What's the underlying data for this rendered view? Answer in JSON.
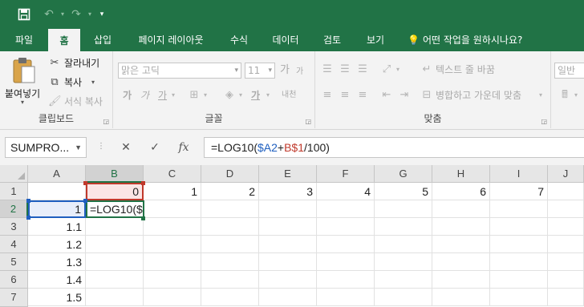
{
  "quick_access": {
    "save_icon": "save-icon",
    "undo_icon": "undo-icon",
    "redo_icon": "redo-icon",
    "customize_icon": "customize-icon"
  },
  "tabs": [
    {
      "label": "파일",
      "active": false
    },
    {
      "label": "홈",
      "active": true
    },
    {
      "label": "삽입",
      "active": false
    },
    {
      "label": "페이지 레이아웃",
      "active": false
    },
    {
      "label": "수식",
      "active": false
    },
    {
      "label": "데이터",
      "active": false
    },
    {
      "label": "검토",
      "active": false
    },
    {
      "label": "보기",
      "active": false
    }
  ],
  "tell_me": "어떤 작업을 원하시나요?",
  "ribbon": {
    "clipboard": {
      "paste_label": "붙여넣기",
      "cut_label": "잘라내기",
      "copy_label": "복사",
      "format_painter_label": "서식 복사",
      "group_label": "클립보드"
    },
    "font": {
      "font_name": "맑은 고딕",
      "font_size": "11",
      "bold": "가",
      "italic": "가",
      "underline": "가",
      "font_color": "가",
      "phonetic": "내천",
      "grow_font": "가",
      "shrink_font": "가",
      "group_label": "글꼴"
    },
    "alignment": {
      "wrap_text_label": "텍스트 줄 바꿈",
      "merge_center_label": "병합하고 가운데 맞춤",
      "group_label": "맞춤"
    },
    "number": {
      "format": "일반"
    }
  },
  "formula_bar": {
    "name_box": "SUMPRO...",
    "cancel_icon": "cancel-icon",
    "enter_icon": "check-icon",
    "fx_label": "fx",
    "formula_prefix": "=LOG10(",
    "formula_ref1": "$A2",
    "formula_plus": "+",
    "formula_ref2": "B$1",
    "formula_suffix": "/100)"
  },
  "grid": {
    "columns": [
      "A",
      "B",
      "C",
      "D",
      "E",
      "F",
      "G",
      "H",
      "I",
      "J"
    ],
    "rows": [
      "1",
      "2",
      "3",
      "4",
      "5",
      "6",
      "7"
    ],
    "row1": [
      "",
      "0",
      "1",
      "2",
      "3",
      "4",
      "5",
      "6",
      "7",
      ""
    ],
    "a_values": [
      "1",
      "1.1",
      "1.2",
      "1.3",
      "1.4",
      "1.5"
    ],
    "b2_edit": "=LOG10($"
  },
  "colors": {
    "accent": "#217346",
    "ref_blue": "#1f5fbf",
    "ref_red": "#c0392b"
  }
}
